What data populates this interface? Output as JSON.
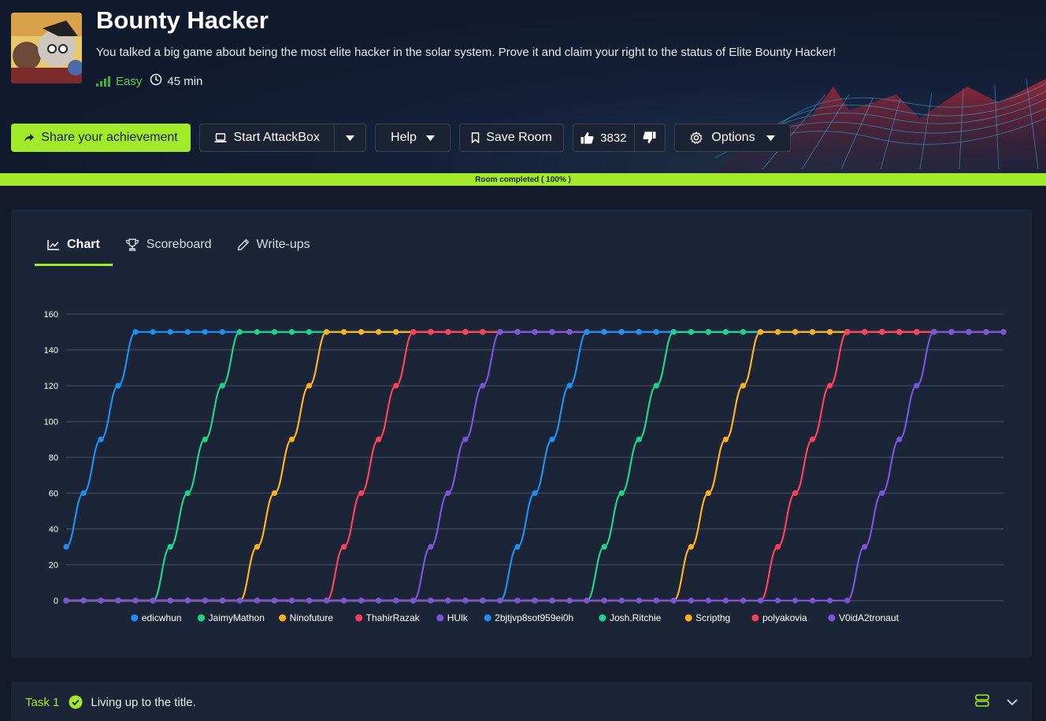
{
  "room": {
    "title": "Bounty Hacker",
    "description": "You talked a big game about being the most elite hacker in the solar system. Prove it and claim your right to the status of Elite Bounty Hacker!",
    "difficulty": "Easy",
    "duration": "45 min"
  },
  "toolbar": {
    "share_label": "Share your achievement",
    "attackbox_label": "Start AttackBox",
    "help_label": "Help",
    "save_label": "Save Room",
    "likes": "3832",
    "options_label": "Options"
  },
  "progress": {
    "label": "Room completed ( 100% )",
    "percent": 100
  },
  "tabs": [
    {
      "label": "Chart",
      "active": true
    },
    {
      "label": "Scoreboard",
      "active": false
    },
    {
      "label": "Write-ups",
      "active": false
    }
  ],
  "colors": {
    "accent": "#a3ea2a",
    "blue": "#1f8ff0",
    "green": "#1fd38a",
    "orange": "#ffb020",
    "red": "#ff3f5e",
    "purple": "#7856d8"
  },
  "chart_data": {
    "type": "line",
    "ylim": [
      0,
      160
    ],
    "y_ticks": [
      0,
      20,
      40,
      60,
      80,
      100,
      120,
      140,
      160
    ],
    "grid": true,
    "legend_position": "bottom",
    "point_count": 55,
    "series": [
      {
        "name": "edicwhun",
        "color": "#1f8ff0",
        "start": 0,
        "values": [
          30,
          60,
          90,
          120,
          150
        ]
      },
      {
        "name": "JaimyMathon",
        "color": "#1fd38a",
        "start": 5,
        "values": [
          0,
          30,
          60,
          90,
          120,
          150
        ]
      },
      {
        "name": "Ninofuture",
        "color": "#ffb020",
        "start": 10,
        "values": [
          0,
          30,
          60,
          90,
          120,
          150
        ]
      },
      {
        "name": "ThahirRazak",
        "color": "#ff3f5e",
        "start": 15,
        "values": [
          0,
          30,
          60,
          90,
          120,
          150
        ]
      },
      {
        "name": "HUlk",
        "color": "#7856d8",
        "start": 20,
        "values": [
          0,
          30,
          60,
          90,
          120,
          150
        ]
      },
      {
        "name": "2bjtjvp8sot959ei0h",
        "color": "#1f8ff0",
        "start": 25,
        "values": [
          0,
          30,
          60,
          90,
          120,
          150
        ]
      },
      {
        "name": "Josh.Ritchie",
        "color": "#1fd38a",
        "start": 30,
        "values": [
          0,
          30,
          60,
          90,
          120,
          150
        ]
      },
      {
        "name": "Scripthg",
        "color": "#ffb020",
        "start": 35,
        "values": [
          0,
          30,
          60,
          90,
          120,
          150
        ]
      },
      {
        "name": "polyakovia",
        "color": "#ff3f5e",
        "start": 40,
        "values": [
          0,
          30,
          60,
          90,
          120,
          150
        ]
      },
      {
        "name": "V0idA2tronaut",
        "color": "#7856d8",
        "start": 45,
        "values": [
          0,
          30,
          60,
          90,
          120,
          150
        ]
      }
    ]
  },
  "task": {
    "number": "Task 1",
    "title": "Living up to the title."
  }
}
